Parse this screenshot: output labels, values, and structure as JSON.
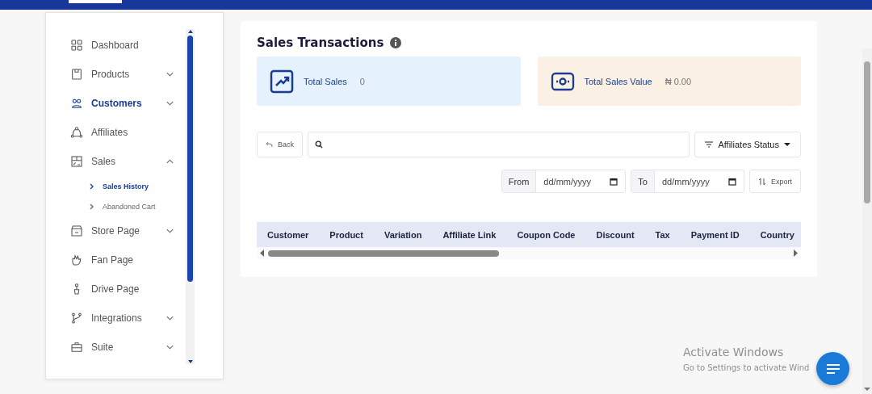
{
  "sidebar": {
    "items": [
      {
        "label": "Dashboard",
        "selected": false
      },
      {
        "label": "Products",
        "selected": false,
        "expanded": false
      },
      {
        "label": "Customers",
        "selected": true,
        "expanded": false
      },
      {
        "label": "Affiliates",
        "selected": false
      },
      {
        "label": "Sales",
        "selected": false,
        "expanded": true,
        "children": [
          {
            "label": "Sales History",
            "selected": true
          },
          {
            "label": "Abandoned Cart",
            "selected": false
          }
        ]
      },
      {
        "label": "Store Page",
        "selected": false,
        "expanded": false
      },
      {
        "label": "Fan Page",
        "selected": false
      },
      {
        "label": "Drive Page",
        "selected": false
      },
      {
        "label": "Integrations",
        "selected": false,
        "expanded": false
      },
      {
        "label": "Suite",
        "selected": false,
        "expanded": false
      }
    ]
  },
  "main": {
    "title": "Sales Transactions",
    "stats": [
      {
        "label": "Total Sales",
        "value": "0",
        "color": "#e5f1fc"
      },
      {
        "label": "Total Sales Value",
        "value": "₦ 0.00",
        "color": "#fbf0e4"
      }
    ],
    "back_button": "Back",
    "filter_button": "Affiliates Status",
    "from_label": "From",
    "from_placeholder": "dd/mm/yyyy",
    "to_label": "To",
    "to_placeholder": "dd/mm/yyyy",
    "export_button": "Export",
    "table": {
      "columns": [
        "Customer",
        "Product",
        "Variation",
        "Affiliate Link",
        "Coupon Code",
        "Discount",
        "Tax",
        "Payment ID",
        "Country"
      ]
    }
  },
  "os_notice": {
    "title": "Activate Windows",
    "text": "Go to Settings to activate Wind"
  }
}
